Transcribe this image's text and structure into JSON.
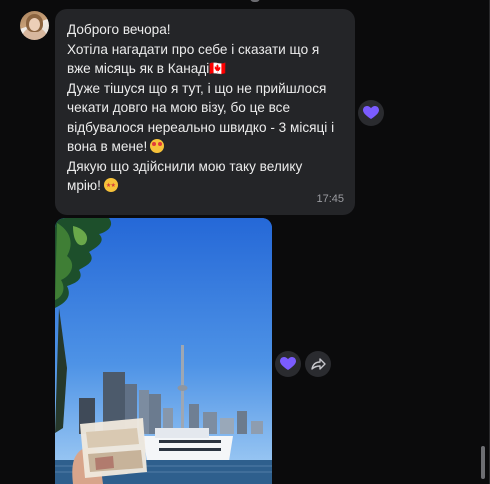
{
  "message": {
    "lines": [
      "Доброго вечора!",
      "Хотіла нагадати про себе і сказати що я",
      "вже місяць як в Канаді🇨🇦",
      "Дуже тішуся що я тут, і що не прийшлося",
      "чекати довго на мою візу, бо це все",
      "відбувалося нереально швидко - 3 місяці і",
      "вона в мене!",
      "Дякую що здійснили мою таку велику",
      "мрію!"
    ],
    "emoji": {
      "line7": "smiling-face-with-hearts",
      "line9": "star-struck"
    },
    "time": "17:45"
  },
  "reaction": {
    "icon": "purple-heart-icon",
    "color": "#7b5cff"
  },
  "colors": {
    "background": "#0b0b0c",
    "bubble": "#242528",
    "text": "#ececec",
    "meta": "#9b9ca1"
  }
}
